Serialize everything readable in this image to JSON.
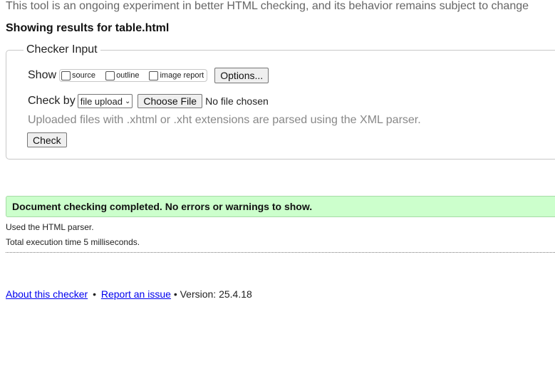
{
  "intro_text": "This tool is an ongoing experiment in better HTML checking, and its behavior remains subject to change",
  "results_title": "Showing results for table.html",
  "checker_input": {
    "legend": "Checker Input",
    "show_label": "Show",
    "options": [
      {
        "label": "source",
        "checked": false
      },
      {
        "label": "outline",
        "checked": false
      },
      {
        "label": "image report",
        "checked": false
      }
    ],
    "options_button": "Options...",
    "check_by_label": "Check by",
    "check_by_selected": "file upload",
    "choose_file_button": "Choose File",
    "no_file_text": "No file chosen",
    "hint": "Uploaded files with .xhtml or .xht extensions are parsed using the XML parser.",
    "check_button": "Check"
  },
  "result": {
    "success_message": "Document checking completed. No errors or warnings to show.",
    "parser_info": "Used the HTML parser.",
    "execution_time": "Total execution time 5 milliseconds."
  },
  "footer": {
    "about_link": "About this checker",
    "separator": "•",
    "report_link": "Report an issue",
    "version_text": "• Version: 25.4.18"
  },
  "colors": {
    "success_bg": "#ccffcc",
    "link": "#0000ee",
    "muted_text": "#888888"
  }
}
